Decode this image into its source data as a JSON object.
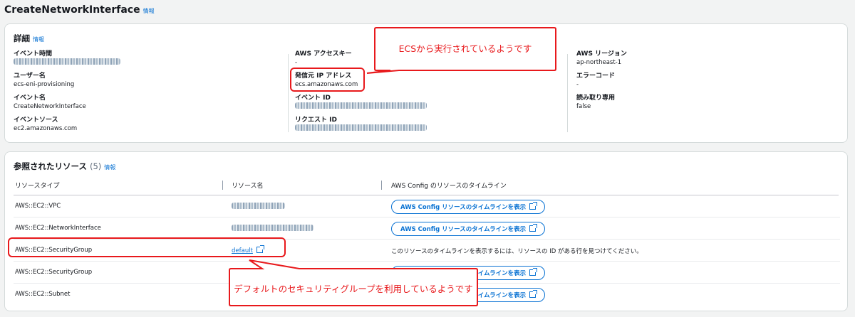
{
  "page": {
    "title": "CreateNetworkInterface",
    "info": "情報"
  },
  "details": {
    "title": "詳細",
    "info": "情報",
    "col1": [
      {
        "label": "イベント時間",
        "value": null,
        "blurred": true
      },
      {
        "label": "ユーザー名",
        "value": "ecs-eni-provisioning"
      },
      {
        "label": "イベント名",
        "value": "CreateNetworkInterface"
      },
      {
        "label": "イベントソース",
        "value": "ec2.amazonaws.com"
      }
    ],
    "col2": [
      {
        "label": "AWS アクセスキー",
        "value": "-"
      },
      {
        "label": "発信元 IP アドレス",
        "value": "ecs.amazonaws.com"
      },
      {
        "label": "イベント ID",
        "value": null,
        "blurred": true
      },
      {
        "label": "リクエスト ID",
        "value": null,
        "blurred": true
      }
    ],
    "col3": [
      {
        "label": "AWS リージョン",
        "value": "ap-northeast-1"
      },
      {
        "label": "エラーコード",
        "value": "-"
      },
      {
        "label": "読み取り専用",
        "value": "false"
      }
    ]
  },
  "resources": {
    "title": "参照されたリソース",
    "count": "(5)",
    "info": "情報",
    "headers": [
      "リソースタイプ",
      "リソース名",
      "AWS Config のリソースのタイムライン"
    ],
    "rows": [
      {
        "type": "AWS::EC2::VPC",
        "name_blurred": true,
        "timeline": "AWS Config リソースのタイムラインを表示"
      },
      {
        "type": "AWS::EC2::NetworkInterface",
        "name_blurred": true,
        "timeline": "AWS Config リソースのタイムラインを表示"
      },
      {
        "type": "AWS::EC2::SecurityGroup",
        "name": "default",
        "timeline_text": "このリソースのタイムラインを表示するには、リソースの ID がある行を見つけてください。"
      },
      {
        "type": "AWS::EC2::SecurityGroup",
        "name_blurred": true,
        "timeline": "AWS Config リソースのタイムラインを表示"
      },
      {
        "type": "AWS::EC2::Subnet",
        "name_blurred": true,
        "timeline": "AWS Config リソースのタイムラインを表示"
      }
    ]
  },
  "annotations": {
    "callout1": "ECSから実行されているようです",
    "callout2": "デフォルトのセキュリティグループを利用しているようです",
    "color": "#e8191c"
  },
  "colors": {
    "accent": "#0972d3",
    "border": "#d5dbdb",
    "background": "#f2f3f3"
  }
}
